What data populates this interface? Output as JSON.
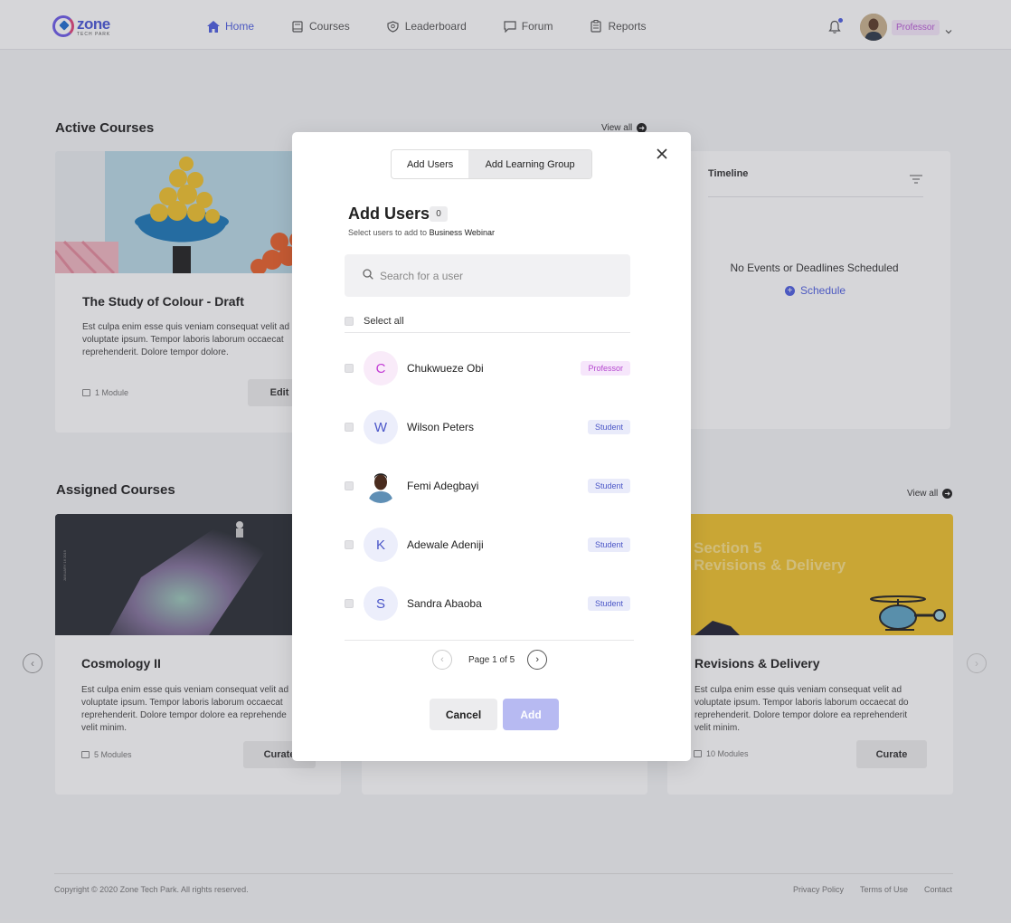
{
  "header": {
    "logo_word": "zone",
    "logo_sub": "TECH PARK",
    "nav": [
      {
        "label": "Home",
        "icon": "home-icon"
      },
      {
        "label": "Courses",
        "icon": "book-icon"
      },
      {
        "label": "Leaderboard",
        "icon": "shield-icon"
      },
      {
        "label": "Forum",
        "icon": "chat-icon"
      },
      {
        "label": "Reports",
        "icon": "clipboard-icon"
      }
    ],
    "role": "Professor"
  },
  "active_courses": {
    "title": "Active Courses",
    "view_all": "View all",
    "card": {
      "title": "The Study of Colour  - Draft",
      "desc": "Est culpa enim esse quis veniam consequat velit ad voluptate ipsum. Tempor laboris laborum occaecat reprehenderit. Dolore tempor dolore.",
      "meta": "1 Module",
      "button": "Edit"
    }
  },
  "timeline": {
    "title": "Timeline",
    "empty": "No Events or Deadlines Scheduled",
    "schedule": "Schedule"
  },
  "assigned_courses": {
    "title": "Assigned Courses",
    "view_all": "View all",
    "cards": [
      {
        "title": "Cosmology II",
        "desc": "Est culpa enim esse quis veniam consequat velit ad voluptate ipsum. Tempor laboris laborum occaecat reprehenderit. Dolore tempor dolore ea reprehende velit minim.",
        "meta": "5 Modules",
        "button": "Curate",
        "image_side_text": "JANUARY 16 2019"
      },
      {
        "title": "Revisions & Delivery",
        "desc": "Est culpa enim esse quis veniam consequat velit ad voluptate ipsum. Tempor laboris laborum occaecat do reprehenderit. Dolore tempor dolore ea reprehenderit velit minim.",
        "meta": "10 Modules",
        "button": "Curate",
        "image_text_1": "Section 5",
        "image_text_2": "Revisions & Delivery"
      }
    ]
  },
  "footer": {
    "copyright": "Copyright © 2020 Zone Tech Park. All rights reserved.",
    "links": [
      "Privacy Policy",
      "Terms of Use",
      "Contact"
    ]
  },
  "modal": {
    "tabs": [
      "Add Users",
      "Add Learning Group"
    ],
    "title": "Add Users",
    "count": "0",
    "subtitle_prefix": "Select users to add to",
    "subtitle_target": "Business Webinar",
    "search_placeholder": "Search for a user",
    "select_all": "Select all",
    "users": [
      {
        "initial": "C",
        "name": "Chukwueze Obi",
        "role": "Professor"
      },
      {
        "initial": "W",
        "name": "Wilson Peters",
        "role": "Student"
      },
      {
        "initial": "",
        "name": "Femi Adegbayi",
        "role": "Student"
      },
      {
        "initial": "K",
        "name": "Adewale Adeniji",
        "role": "Student"
      },
      {
        "initial": "S",
        "name": "Sandra Abaoba",
        "role": "Student"
      }
    ],
    "pagination": "Page 1 of 5",
    "cancel": "Cancel",
    "add": "Add"
  },
  "colors": {
    "accent": "#4f5fe0",
    "add_disabled": "#b7baf2",
    "professor_tag": "#b548cf",
    "student_tag": "#4b56c7"
  }
}
